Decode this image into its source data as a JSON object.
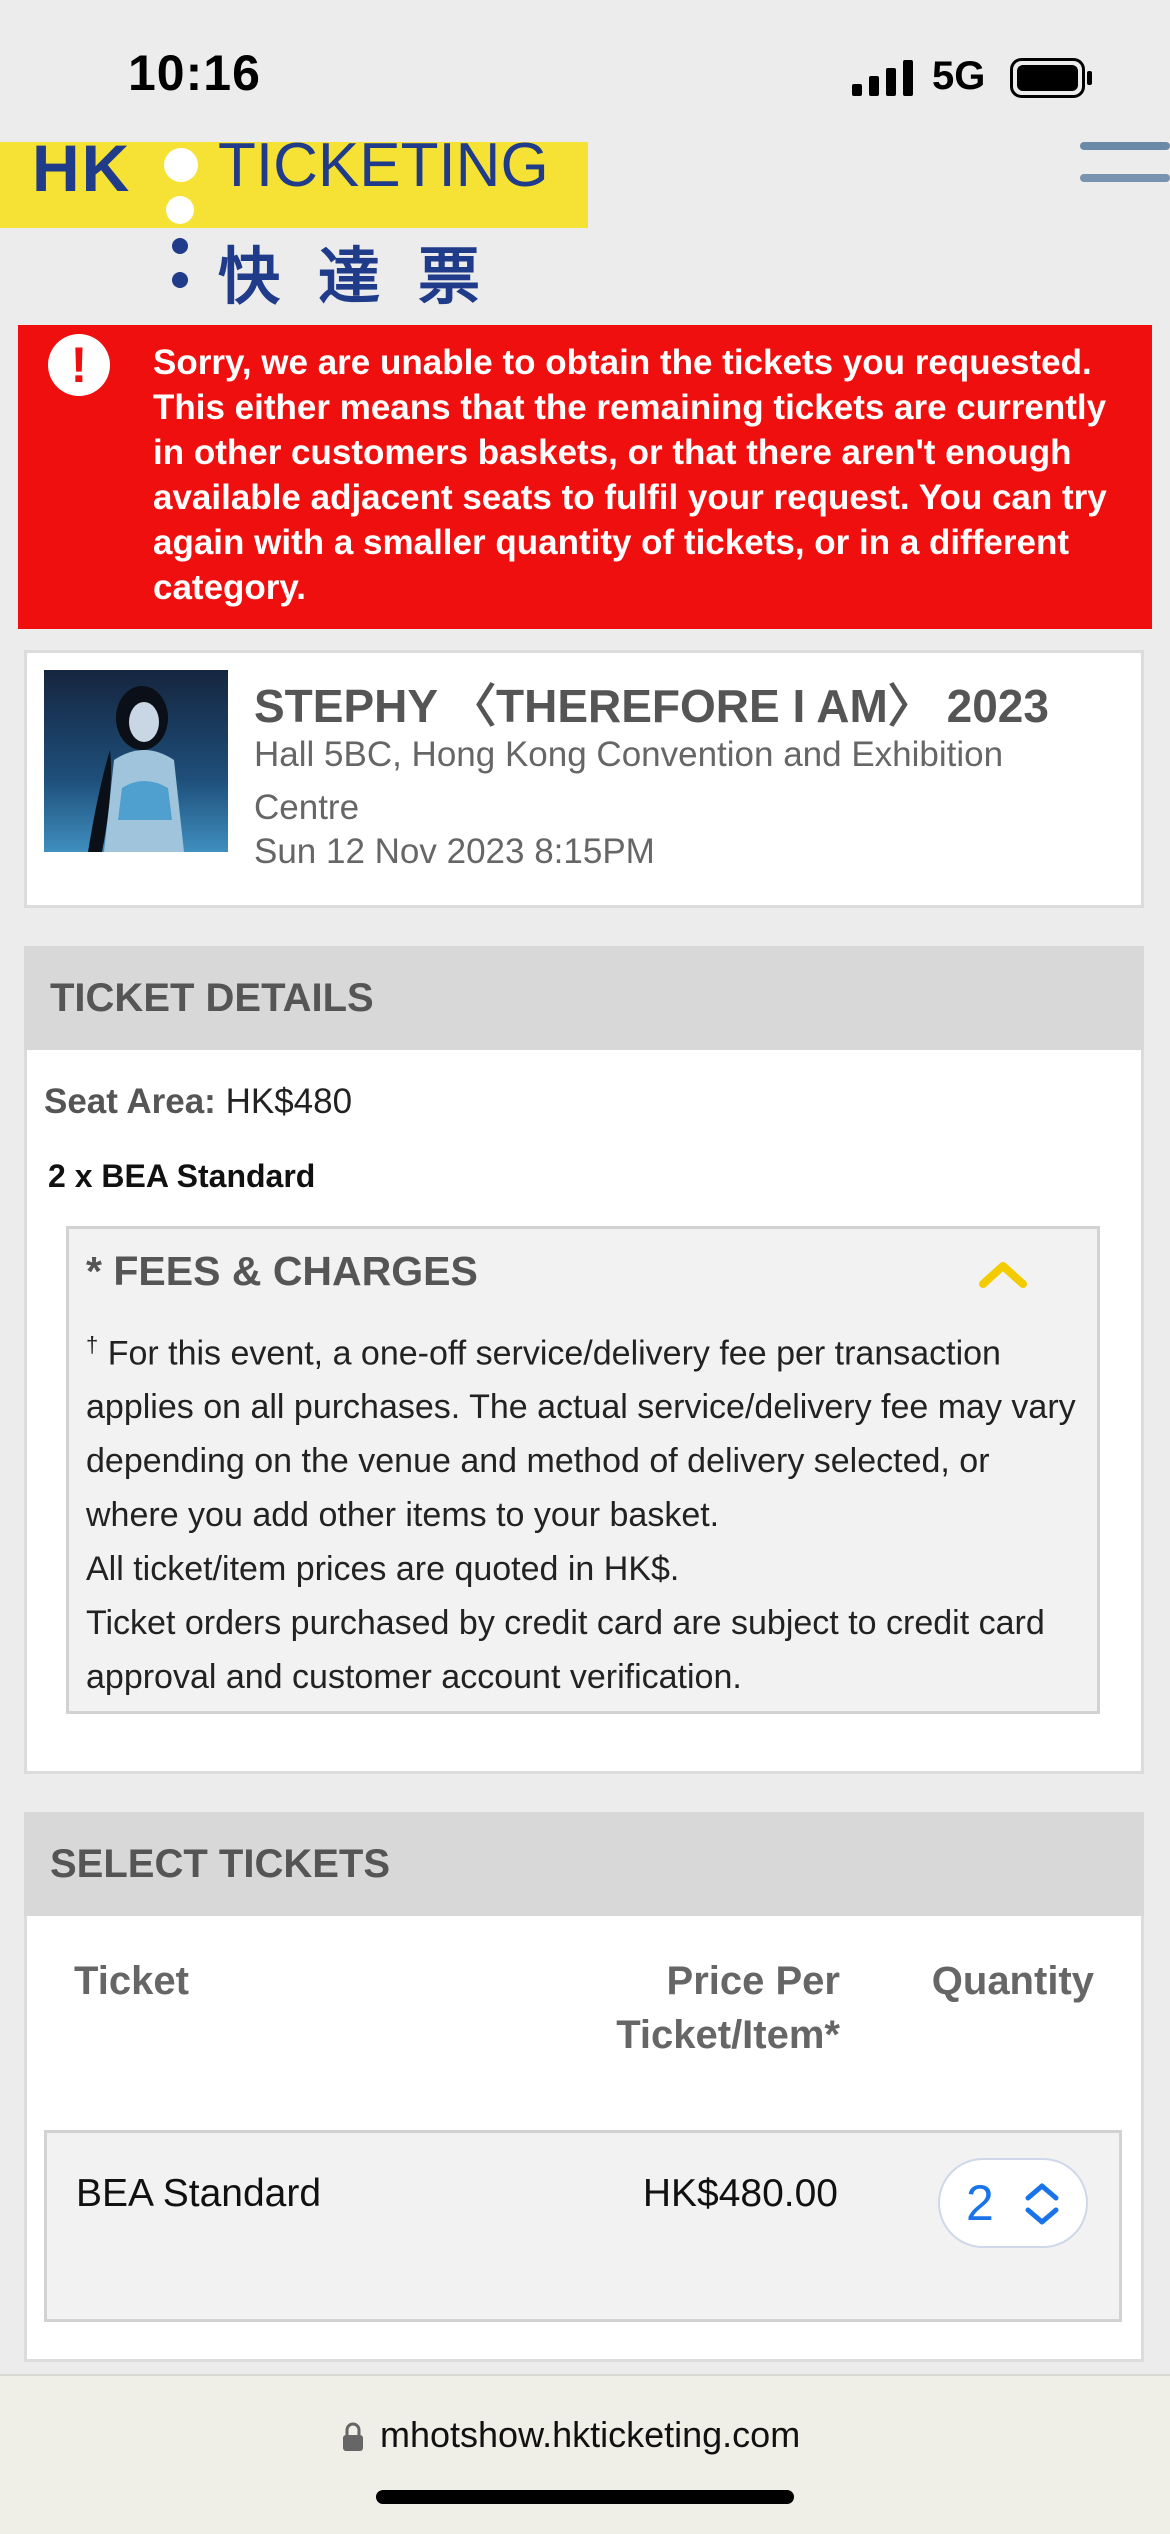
{
  "status_bar": {
    "time": "10:16",
    "network": "5G"
  },
  "header": {
    "logo": {
      "hk": "HK",
      "ticketing": "TICKETING",
      "chinese": "快達票"
    },
    "menu_icon": "hamburger-menu-icon"
  },
  "error": {
    "icon": "exclamation-icon",
    "message": "Sorry, we are unable to obtain the tickets you requested. This either means that the remaining tickets are currently in other customers baskets, or that there aren't enough available adjacent seats to fulfil your request. You can try again with a smaller quantity of tickets, or in a different category."
  },
  "event": {
    "title": "STEPHY 〈THEREFORE I AM〉 2023",
    "venue": "Hall 5BC, Hong Kong Convention and Exhibition Centre",
    "date": "Sun 12 Nov 2023 8:15PM"
  },
  "ticket_details": {
    "heading": "TICKET DETAILS",
    "seat_area_label": "Seat Area:",
    "seat_area_value": "HK$480",
    "summary": "2 x BEA Standard",
    "fees": {
      "heading": "* FEES & CHARGES",
      "dagger": "†",
      "line1": "For this event, a one-off service/delivery fee per transaction applies on all purchases. The actual service/delivery fee may vary depending on the venue and method of delivery selected, or where you add other items to your basket.",
      "line2": "All ticket/item prices are quoted in HK$.",
      "line3": "Ticket orders purchased by credit card are subject to credit card approval and customer account verification."
    }
  },
  "select_tickets": {
    "heading": "SELECT TICKETS",
    "columns": {
      "ticket": "Ticket",
      "price": "Price Per Ticket/Item*",
      "quantity": "Quantity"
    },
    "rows": [
      {
        "name": "BEA Standard",
        "price": "HK$480.00",
        "quantity": "2"
      }
    ]
  },
  "browser": {
    "url": "mhotshow.hkticketing.com"
  },
  "colors": {
    "error_red": "#f00f0f",
    "logo_yellow": "#f6e234",
    "logo_blue": "#1f3b8a",
    "link_blue": "#1a73e8",
    "chevron_yellow": "#f2cc00"
  }
}
